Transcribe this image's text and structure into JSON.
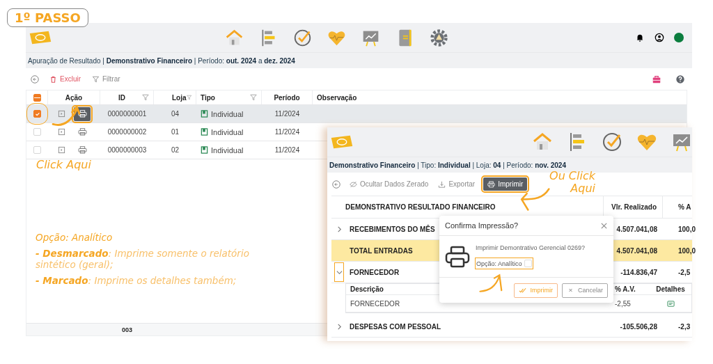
{
  "step_badge": "1º PASSO",
  "main": {
    "breadcrumb": "Apuração de Resultado | **Demonstrativo Financeiro** | Período: **out. 2024** a **dez. 2024**",
    "toolbar": {
      "delete": "Excluir",
      "filter": "Filtrar"
    },
    "select_all_partial": true,
    "columns": [
      {
        "label": "Ação",
        "filter": false
      },
      {
        "label": "ID",
        "filter": true
      },
      {
        "label": "Loja",
        "filter": true
      },
      {
        "label": "Tipo",
        "filter": true
      },
      {
        "label": "Período",
        "filter": false
      },
      {
        "label": "Observação",
        "filter": false
      }
    ],
    "rows": [
      {
        "id": "0000000001",
        "store": "04",
        "type": "Individual",
        "period": "11/2024",
        "selected": true
      },
      {
        "id": "0000000002",
        "store": "01",
        "type": "Individual",
        "period": "11/2024",
        "selected": false
      },
      {
        "id": "0000000003",
        "store": "02",
        "type": "Individual",
        "period": "11/2024",
        "selected": false
      }
    ],
    "footer_count": "003"
  },
  "annotations": {
    "click_here": "Click Aqui",
    "or_click_here": "Ou Click Aqui",
    "option_title": "Opção: Analítico",
    "option_notes": [
      "**- Desmarcado**: Imprime somente o relatório sintético (geral);",
      "**- Marcado**: Imprime os detalhes também;"
    ]
  },
  "report": {
    "breadcrumb": "**Demonstrativo Financeiro** | Tipo: **Individual** | Loja: **04** | Período: **nov. 2024**",
    "toolbar": {
      "hide_zero": "Ocultar Dados Zerado",
      "export": "Exportar",
      "print": "Imprimir"
    },
    "columns": [
      "DEMONSTRATIVO RESULTADO FINANCEIRO",
      "Vlr. Realizado",
      "% A"
    ],
    "rows": [
      {
        "kind": "group",
        "label": "RECEBIMENTOS DO MÊS",
        "value": "4.507.041,08",
        "share": "100,0",
        "expanded": false
      },
      {
        "kind": "total",
        "label": "TOTAL ENTRADAS",
        "value": "4.507.041,08",
        "share": "100,0"
      },
      {
        "kind": "group",
        "label": "FORNECEDOR",
        "value": "-114.836,47",
        "share": "-2,5",
        "expanded": true,
        "detail": {
          "columns": [
            "Descrição",
            "% A.V.",
            "Detalhes"
          ],
          "rows": [
            {
              "description": "FORNECEDOR",
              "share": "-2,55"
            }
          ]
        }
      },
      {
        "kind": "group",
        "label": "DESPESAS COM PESSOAL",
        "value": "-105.506,28",
        "share": "-2,3",
        "expanded": false
      }
    ]
  },
  "dialog": {
    "title": "Confirma Impressão?",
    "message": "Imprimir Demontrativo Gerencial 0269?",
    "option": "Opção: Analítico",
    "checked": false,
    "confirm": "Imprimir",
    "cancel": "Cancelar"
  }
}
